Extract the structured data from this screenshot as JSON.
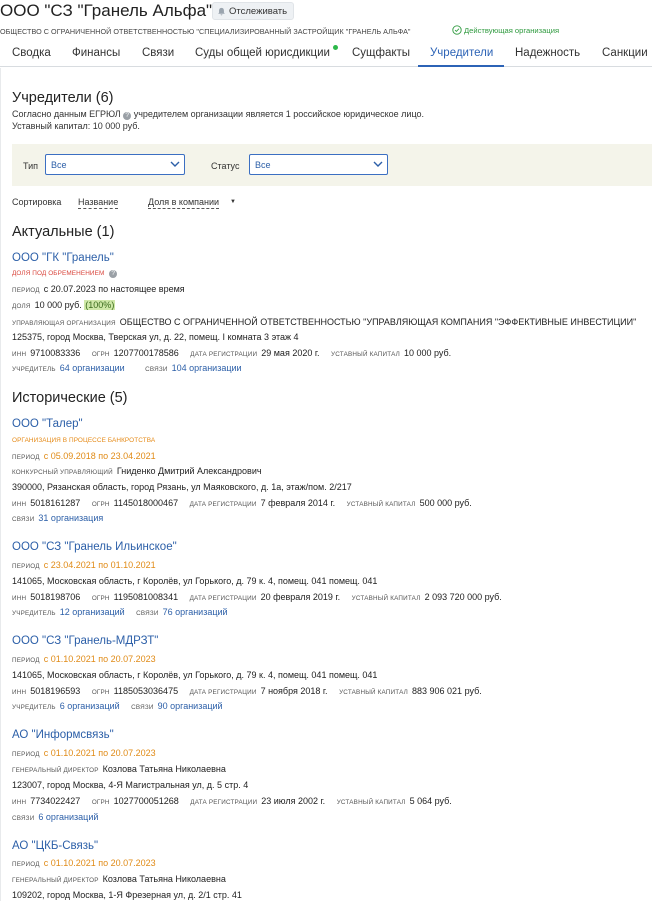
{
  "header": {
    "company_title": "ООО \"СЗ \"Гранель Альфа\"",
    "track_label": "Отслеживать",
    "full_name": "ОБЩЕСТВО С ОГРАНИЧЕННОЙ ОТВЕТСТВЕННОСТЬЮ \"СПЕЦИАЛИЗИРОВАННЫЙ ЗАСТРОЙЩИК \"ГРАНЕЛЬ АЛЬФА\"",
    "status": "Действующая организация"
  },
  "tabs": [
    "Сводка",
    "Финансы",
    "Связи",
    "Суды общей юрисдикции",
    "Сущфакты",
    "Учредители",
    "Надежность",
    "Санкции"
  ],
  "active_tab": "Учредители",
  "founders": {
    "title": "Учредители (6)",
    "note_line1_a": "Согласно данным ЕГРЮЛ",
    "note_line1_b": "учредителем организации является 1 российское юридическое лицо.",
    "note_line2": "Уставный капитал: 10 000 руб."
  },
  "filters": {
    "type_label": "Тип",
    "type_value": "Все",
    "status_label": "Статус",
    "status_value": "Все"
  },
  "sort": {
    "label": "Сортировка",
    "by_name": "Название",
    "by_share": "Доля в компании",
    "arrow": "▼"
  },
  "labels": {
    "period": "ПЕРИОД",
    "share": "ДОЛЯ",
    "manager_org": "УПРАВЛЯЮЩАЯ ОРГАНИЗАЦИЯ",
    "inn": "ИНН",
    "ogrn": "ОГРН",
    "reg_date": "ДАТА РЕГИСТРАЦИИ",
    "capital": "УСТАВНЫЙ КАПИТАЛ",
    "founder": "УЧРЕДИТЕЛЬ",
    "links": "СВЯЗИ",
    "bankruptcy_manager": "КОНКУРСНЫЙ УПРАВЛЯЮЩИЙ",
    "general_director": "ГЕНЕРАЛЬНЫЙ ДИРЕКТОР"
  },
  "actual": {
    "title": "Актуальные (1)",
    "items": [
      {
        "name": "ООО \"ГК \"Гранель\"",
        "badge": "ДОЛЯ ПОД ОБРЕМЕНЕНИЕМ",
        "period": "с 20.07.2023 по настоящее время",
        "share": "10 000 руб.",
        "share_pct": "(100%)",
        "manager_org": "ОБЩЕСТВО С ОГРАНИЧЕННОЙ ОТВЕТСТВЕННОСТЬЮ \"УПРАВЛЯЮЩАЯ КОМПАНИЯ \"ЭФФЕКТИВНЫЕ ИНВЕСТИЦИИ\"",
        "address": "125375, город Москва, Тверская ул, д. 22, помещ. I комната 3 этаж 4",
        "inn": "9710083336",
        "ogrn": "1207700178586",
        "reg_date": "29 мая 2020 г.",
        "capital": "10 000 руб.",
        "founder_link": "64 организации",
        "links_link": "104 организации"
      }
    ]
  },
  "historical": {
    "title": "Исторические (5)",
    "items": [
      {
        "name": "ООО \"Талер\"",
        "badge": "ОРГАНИЗАЦИЯ В ПРОЦЕССЕ БАНКРОТСТВА",
        "period": "с 05.09.2018 по 23.04.2021",
        "person": "Гниденко Дмитрий Александрович",
        "address": "390000, Рязанская область, город Рязань, ул Маяковского, д. 1а, этаж/пом. 2/217",
        "inn": "5018161287",
        "ogrn": "1145018000467",
        "reg_date": "7 февраля 2014 г.",
        "capital": "500 000 руб.",
        "links_link": "31 организация"
      },
      {
        "name": "ООО \"СЗ \"Гранель Ильинское\"",
        "period": "с 23.04.2021 по 01.10.2021",
        "address": "141065, Московская область, г Королёв, ул Горького, д. 79 к. 4, помещ. 041 помещ. 041",
        "inn": "5018198706",
        "ogrn": "1195081008341",
        "reg_date": "20 февраля 2019 г.",
        "capital": "2 093 720 000 руб.",
        "founder_link": "12 организаций",
        "links_link": "76 организаций"
      },
      {
        "name": "ООО \"СЗ \"Гранель-МДРЗТ\"",
        "period": "с 01.10.2021 по 20.07.2023",
        "address": "141065, Московская область, г Королёв, ул Горького, д. 79 к. 4, помещ. 041 помещ. 041",
        "inn": "5018196593",
        "ogrn": "1185053036475",
        "reg_date": "7 ноября 2018 г.",
        "capital": "883 906 021 руб.",
        "founder_link": "6 организаций",
        "links_link": "90 организаций"
      },
      {
        "name": "АО \"Информсвязь\"",
        "period": "с 01.10.2021 по 20.07.2023",
        "person": "Козлова Татьяна Николаевна",
        "address": "123007, город Москва, 4-Я Магистральная ул, д. 5 стр. 4",
        "inn": "7734022427",
        "ogrn": "1027700051268",
        "reg_date": "23 июля 2002 г.",
        "capital": "5 064 руб.",
        "links_link": "6 организаций"
      },
      {
        "name": "АО \"ЦКБ-Связь\"",
        "period": "с 01.10.2021 по 20.07.2023",
        "person": "Козлова Татьяна Николаевна",
        "address": "109202, город Москва, 1-Я Фрезерная ул, д. 2/1 стр. 41"
      }
    ]
  },
  "colors": {
    "accent": "#2c63b6",
    "link": "#2c5fa8",
    "ok": "#2f9a3f",
    "warning": "#e58a17",
    "danger": "#d9453c"
  }
}
